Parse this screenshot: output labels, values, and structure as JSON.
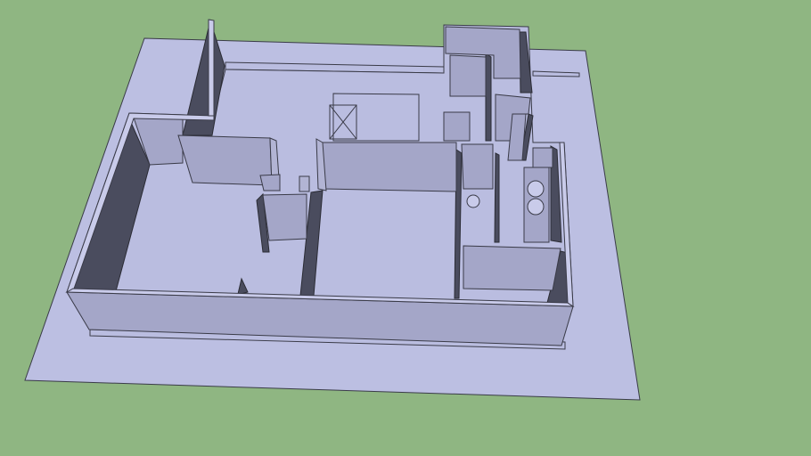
{
  "scene": {
    "subject": "3d-floor-plan-model",
    "colors": {
      "background": "#8fb682",
      "ground": "#bcbfe2",
      "floor": "#babde0",
      "wall_top": "#c9cbea",
      "wall_face": "#a4a6c8",
      "wall_face_light": "#b2b4d4",
      "wall_shadow": "#4a4c5e",
      "edge": "#3a3b48"
    }
  }
}
